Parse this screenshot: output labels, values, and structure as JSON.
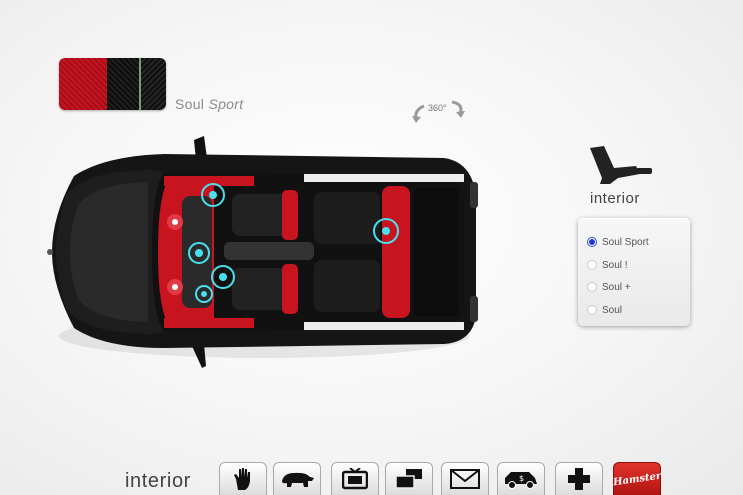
{
  "trim": {
    "swatch_name": "Soul",
    "swatch_name_italic": "Sport"
  },
  "rotate": {
    "label": "360°"
  },
  "interior_panel": {
    "title": "interior",
    "options": [
      {
        "label": "Soul Sport",
        "selected": true
      },
      {
        "label": "Soul !",
        "selected": false
      },
      {
        "label": "Soul +",
        "selected": false
      },
      {
        "label": "Soul",
        "selected": false
      }
    ]
  },
  "toolbar": {
    "label": "interior",
    "items": [
      "hand-icon",
      "animal-icon",
      "tv-icon",
      "stack-icon",
      "mail-icon",
      "car-price-icon",
      "cross-icon",
      "brand-logo"
    ],
    "brand_text": "Hamster"
  },
  "colors": {
    "accent_red": "#c8141f",
    "radio_blue": "#1d3bd8",
    "hotspot_cyan": "#49e0ee"
  }
}
